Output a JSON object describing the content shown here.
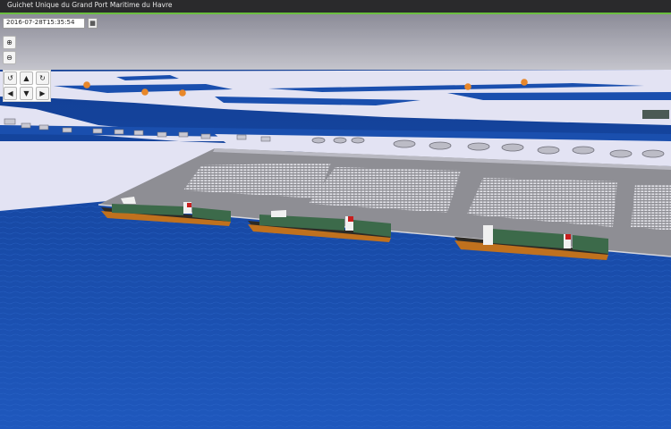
{
  "window": {
    "title": "Guichet Unique du Grand Port Maritime du Havre"
  },
  "controls": {
    "date_value": "2016-07-28T15:35:54",
    "calendar_icon": "calendar-icon",
    "zoom_in_icon": "zoom-in-icon",
    "zoom_out_icon": "zoom-out-icon",
    "nav_icons": [
      "rotate-left-icon",
      "arrow-up-icon",
      "rotate-right-icon",
      "arrow-left-icon",
      "arrow-down-icon",
      "arrow-right-icon"
    ]
  },
  "colors": {
    "sea": "#1a4fae",
    "land": "#e2e2f2",
    "quay": "#8e8e94",
    "sky": "#a9a9b3",
    "marker": "#e8872a",
    "titlebar_accent": "#6abf3f"
  }
}
